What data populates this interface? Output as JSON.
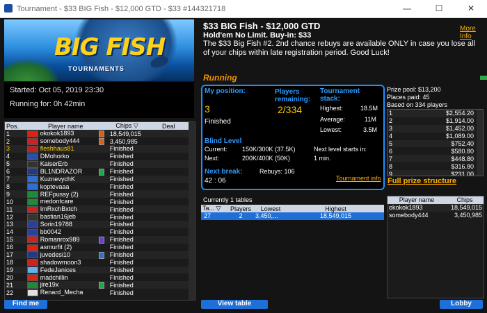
{
  "window": {
    "title": "Tournament - $33 BIG Fish - $12,000 GTD - $33 #144321718",
    "minimize": "—",
    "maximize": "☐",
    "close": "✕"
  },
  "banner": {
    "line1": "BIG",
    "line2": "FISH",
    "sub": "TOURNAMENTS"
  },
  "left_info": {
    "started": "Started: Oct 05, 2019 23:30",
    "running_for": "Running for: 0h 42min"
  },
  "header": {
    "title": "$33 BIG Fish - $12,000 GTD",
    "subtitle": "Hold'em No Limit. Buy-in: $33",
    "description": "The $33 Big Fish #2. 2nd chance rebuys are available ONLY in case you lose all of your chips within late registration period. Good Luck!",
    "more_info": "More Info",
    "status": "Running"
  },
  "stats": {
    "my_position_label": "My position:",
    "my_position_value": "3",
    "finished": "Finished",
    "players_remaining_label": "Players remaining:",
    "players_remaining_value": "2/334",
    "stack_label": "Tournament stack:",
    "highest_label": "Highest:",
    "highest_value": "18.5M",
    "average_label": "Average:",
    "average_value": "11M",
    "lowest_label": "Lowest:",
    "lowest_value": "3.5M",
    "blind_level_label": "Blind Level",
    "current_label": "Current:",
    "current_value": "150K/300K (37.5K)",
    "next_label": "Next:",
    "next_value": "200K/400K (50K)",
    "next_level_label": "Next level starts in:",
    "next_level_value": "1 min.",
    "next_break_label": "Next break:",
    "next_break_value": "42 : 06",
    "rebuys": "Rebuys: 106",
    "tournament_info": "Tournament info"
  },
  "prizes": {
    "prize_pool": "Prize pool: $13,200",
    "places_paid": "Places paid: 45",
    "based_on": "Based on 334 players",
    "rows": [
      {
        "place": "1",
        "amount": "$2,554.20"
      },
      {
        "place": "2",
        "amount": "$1,914.00"
      },
      {
        "place": "3",
        "amount": "$1,452.00"
      },
      {
        "place": "4",
        "amount": "$1,089.00"
      },
      {
        "place": "5",
        "amount": "$752.40"
      },
      {
        "place": "6",
        "amount": "$580.80"
      },
      {
        "place": "7",
        "amount": "$448.80"
      },
      {
        "place": "8",
        "amount": "$316.80"
      },
      {
        "place": "9",
        "amount": "$231.00"
      }
    ],
    "full_structure": "Full prize structure"
  },
  "players": {
    "columns": [
      "Pos.",
      "Player name",
      "Chips",
      "Deal"
    ],
    "rows": [
      {
        "pos": "1",
        "name": "okokok1893",
        "chips": "18,549,015",
        "flag": "#d21",
        "badge": "#d8601a",
        "highlight": false
      },
      {
        "pos": "2",
        "name": "somebody444",
        "chips": "3,450,985",
        "flag": "#c22",
        "badge": "#d8601a",
        "highlight": false
      },
      {
        "pos": "3",
        "name": "fleshhaus81",
        "chips": "Finished",
        "flag": "#b22",
        "badge": "",
        "highlight": true
      },
      {
        "pos": "4",
        "name": "DMohorko",
        "chips": "Finished",
        "flag": "#2b4fa8",
        "badge": "",
        "highlight": false
      },
      {
        "pos": "5",
        "name": "KaiserErb",
        "chips": "Finished",
        "flag": "#333",
        "badge": "",
        "highlight": false
      },
      {
        "pos": "6",
        "name": "BL1NDRAZOR",
        "chips": "Finished",
        "flag": "#203a88",
        "badge": "#1fa84a",
        "highlight": false
      },
      {
        "pos": "7",
        "name": "KuznevychK",
        "chips": "Finished",
        "flag": "#2e6fd6",
        "badge": "",
        "highlight": false
      },
      {
        "pos": "8",
        "name": "koptevaaa",
        "chips": "Finished",
        "flag": "#2e6fd6",
        "badge": "",
        "highlight": false
      },
      {
        "pos": "9",
        "name": "REFpussy (2)",
        "chips": "Finished",
        "flag": "#1e8a3a",
        "badge": "",
        "highlight": false
      },
      {
        "pos": "10",
        "name": "medontcare",
        "chips": "Finished",
        "flag": "#1e8a3a",
        "badge": "",
        "highlight": false
      },
      {
        "pos": "11",
        "name": "ImRxchBxtch",
        "chips": "Finished",
        "flag": "#c22",
        "badge": "",
        "highlight": false
      },
      {
        "pos": "12",
        "name": "bastian16jeb",
        "chips": "Finished",
        "flag": "#333",
        "badge": "",
        "highlight": false
      },
      {
        "pos": "13",
        "name": "Sorin19788",
        "chips": "Finished",
        "flag": "#2a3fa0",
        "badge": "",
        "highlight": false
      },
      {
        "pos": "14",
        "name": "bb0042",
        "chips": "Finished",
        "flag": "#2a3fa0",
        "badge": "",
        "highlight": false
      },
      {
        "pos": "15",
        "name": "Romanrox989",
        "chips": "Finished",
        "flag": "#c22",
        "badge": "#6a3fd0",
        "highlight": false
      },
      {
        "pos": "16",
        "name": "asmurfit (2)",
        "chips": "Finished",
        "flag": "#d21",
        "badge": "",
        "highlight": false
      },
      {
        "pos": "17",
        "name": "juvedesi10",
        "chips": "Finished",
        "flag": "#203a88",
        "badge": "#2e6fd6",
        "highlight": false
      },
      {
        "pos": "18",
        "name": "shadowmoon3",
        "chips": "Finished",
        "flag": "#c22",
        "badge": "",
        "highlight": false
      },
      {
        "pos": "19",
        "name": "FedeJanices",
        "chips": "Finished",
        "flag": "#6ab0e8",
        "badge": "",
        "highlight": false
      },
      {
        "pos": "20",
        "name": "madchillin",
        "chips": "Finished",
        "flag": "#d21",
        "badge": "",
        "highlight": false
      },
      {
        "pos": "21",
        "name": "jire19x",
        "chips": "Finished",
        "flag": "#1e8a3a",
        "badge": "#1fa84a",
        "highlight": false
      },
      {
        "pos": "22",
        "name": "Renard_Mecha",
        "chips": "Finished",
        "flag": "#e0e0e0",
        "badge": "",
        "highlight": false
      }
    ],
    "find_me": "Find me"
  },
  "tables_panel": {
    "header": "Currently 1 tables",
    "columns": [
      "Ta...",
      "Players",
      "Lowest",
      "Highest"
    ],
    "rows": [
      {
        "table": "27",
        "players": "2",
        "lowest": "3,450,...",
        "highest": "18,549,015"
      }
    ],
    "view_table": "View table"
  },
  "table_players": {
    "columns": [
      "Player name",
      "Chips"
    ],
    "rows": [
      {
        "name": "okokok1893",
        "chips": "18,549,015"
      },
      {
        "name": "somebody444",
        "chips": "3,450,985"
      }
    ],
    "lobby": "Lobby"
  }
}
